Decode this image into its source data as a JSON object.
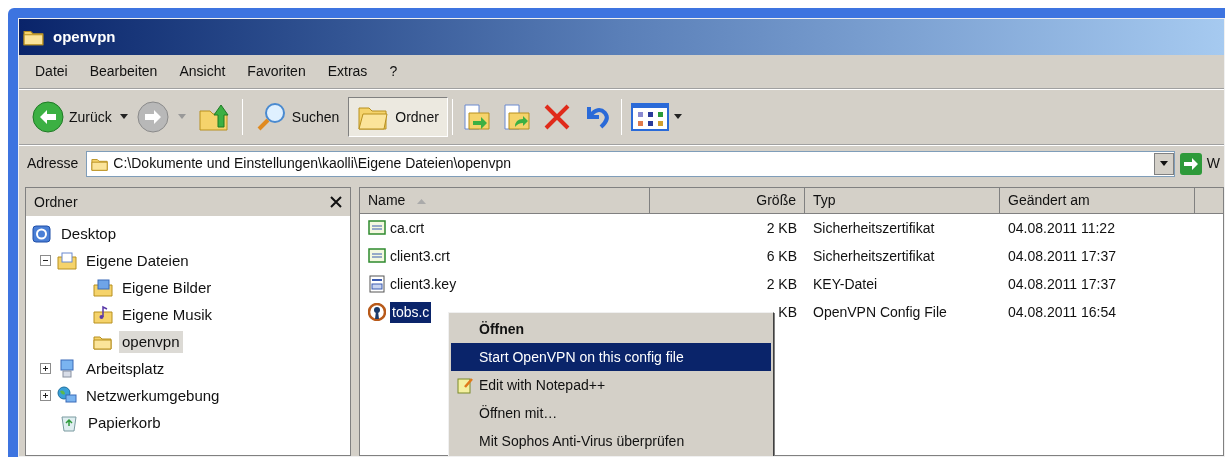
{
  "window": {
    "title": "openvpn"
  },
  "menu": [
    "Datei",
    "Bearbeiten",
    "Ansicht",
    "Favoriten",
    "Extras",
    "?"
  ],
  "toolbar": [
    {
      "kind": "back",
      "label": "Zurück"
    },
    {
      "kind": "forward"
    },
    {
      "kind": "up"
    },
    {
      "kind": "separator"
    },
    {
      "kind": "search",
      "label": "Suchen",
      "pressed": false
    },
    {
      "kind": "folders",
      "label": "Ordner",
      "pressed": true
    },
    {
      "kind": "separator"
    },
    {
      "kind": "move"
    },
    {
      "kind": "copy"
    },
    {
      "kind": "delete"
    },
    {
      "kind": "undo"
    },
    {
      "kind": "separator"
    },
    {
      "kind": "views"
    }
  ],
  "address": {
    "label": "Adresse",
    "value": "C:\\Dokumente und Einstellungen\\kaolli\\Eigene Dateien\\openvpn",
    "go": "W"
  },
  "folders_pane": {
    "title": "Ordner",
    "tree": [
      {
        "label": "Desktop",
        "kind": "desktop",
        "selected": false,
        "children": [
          {
            "label": "Eigene Dateien",
            "kind": "documents",
            "expanded": true,
            "selected": false,
            "children": [
              {
                "label": "Eigene Bilder",
                "kind": "pictures",
                "selected": false
              },
              {
                "label": "Eigene Musik",
                "kind": "music",
                "selected": false
              },
              {
                "label": "openvpn",
                "kind": "folder",
                "selected": true
              }
            ]
          },
          {
            "label": "Arbeitsplatz",
            "kind": "computer",
            "expanded": false,
            "selected": false
          },
          {
            "label": "Netzwerkumgebung",
            "kind": "network",
            "expanded": false,
            "selected": false
          },
          {
            "label": "Papierkorb",
            "kind": "trash",
            "selected": false
          }
        ]
      }
    ]
  },
  "files": {
    "columns": [
      {
        "label": "Name",
        "sorted": true
      },
      {
        "label": "Größe",
        "sorted": false
      },
      {
        "label": "Typ",
        "sorted": false
      },
      {
        "label": "Geändert am",
        "sorted": false
      }
    ],
    "rows": [
      {
        "name": "ca.crt",
        "kind": "cert",
        "size": "2 KB",
        "type": "Sicherheitszertifikat",
        "modified": "04.08.2011 11:22",
        "selected": false
      },
      {
        "name": "client3.crt",
        "kind": "cert",
        "size": "6 KB",
        "type": "Sicherheitszertifikat",
        "modified": "04.08.2011 17:37",
        "selected": false
      },
      {
        "name": "client3.key",
        "kind": "key",
        "size": "2 KB",
        "type": "KEY-Datei",
        "modified": "04.08.2011 17:37",
        "selected": false
      },
      {
        "name": "tobs.c",
        "kind": "openvpn",
        "size": "KB",
        "type": "OpenVPN Config File",
        "modified": "04.08.2011 16:54",
        "selected": true
      }
    ]
  },
  "context_menu": [
    {
      "label": "Öffnen",
      "default": true,
      "selected": false,
      "kind": "plain"
    },
    {
      "label": "Start OpenVPN on this config file",
      "default": false,
      "selected": true,
      "kind": "plain"
    },
    {
      "label": "Edit with Notepad++",
      "default": false,
      "selected": false,
      "kind": "notepad"
    },
    {
      "label": "Öffnen mit…",
      "default": false,
      "selected": false,
      "kind": "plain"
    },
    {
      "label": "Mit Sophos Anti-Virus überprüfen",
      "default": false,
      "selected": false,
      "kind": "plain"
    }
  ]
}
